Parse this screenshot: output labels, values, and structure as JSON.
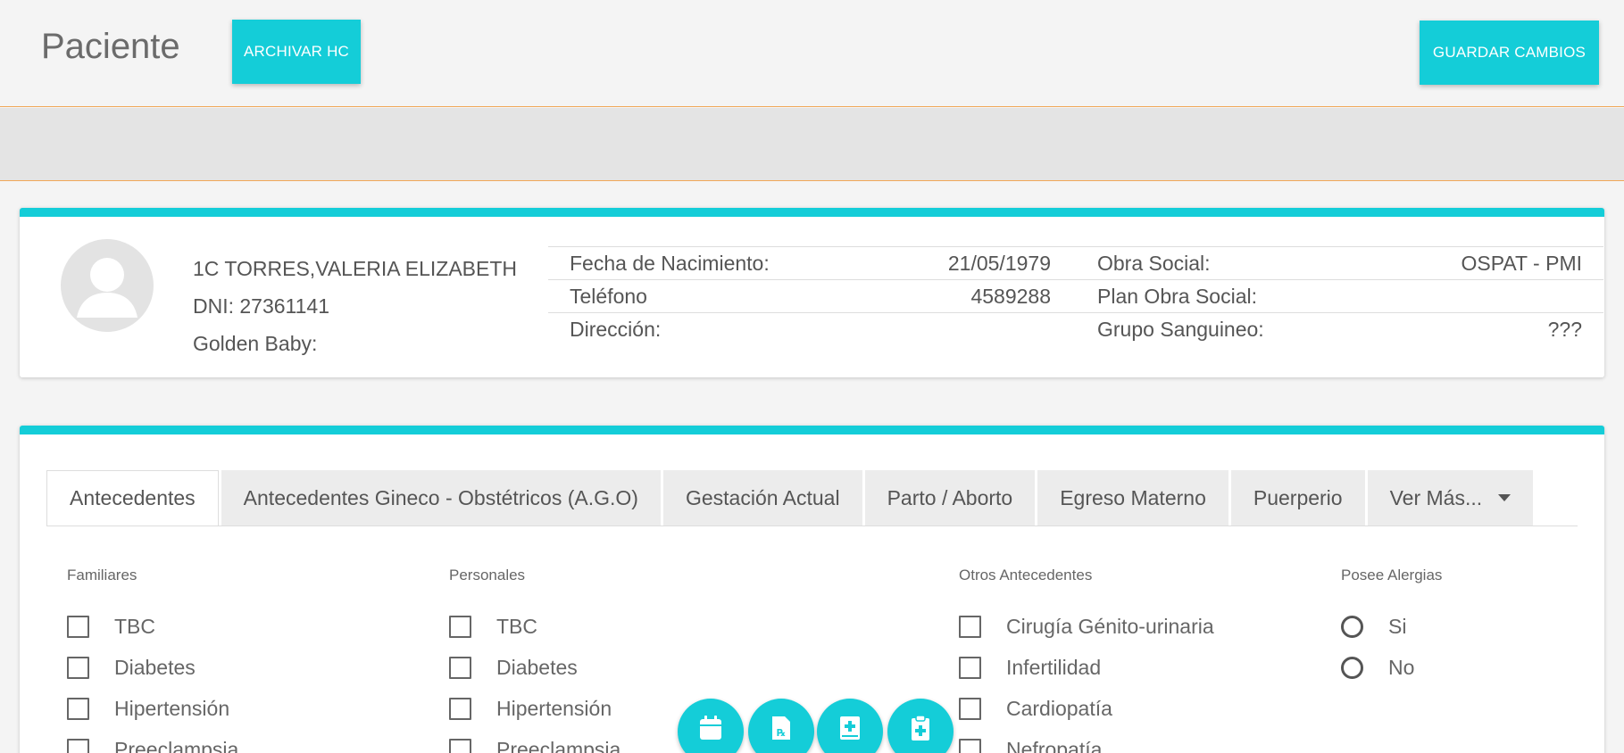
{
  "header": {
    "title": "Paciente",
    "archive_label": "ARCHIVAR HC",
    "save_label": "GUARDAR CAMBIOS"
  },
  "patient": {
    "name": "1C TORRES,VALERIA ELIZABETH",
    "dni": "DNI: 27361141",
    "golden_baby": "Golden Baby:",
    "rows": [
      {
        "l1": "Fecha de Nacimiento:",
        "v1": "21/05/1979",
        "l2": "Obra Social:",
        "v2": "OSPAT - PMI"
      },
      {
        "l1": "Teléfono",
        "v1": "4589288",
        "l2": "Plan Obra Social:",
        "v2": ""
      },
      {
        "l1": "Dirección:",
        "v1": "",
        "l2": "Grupo Sanguineo:",
        "v2": "???"
      }
    ]
  },
  "tabs": [
    {
      "label": "Antecedentes"
    },
    {
      "label": "Antecedentes Gineco - Obstétricos (A.G.O)"
    },
    {
      "label": "Gestación Actual"
    },
    {
      "label": "Parto / Aborto"
    },
    {
      "label": "Egreso Materno"
    },
    {
      "label": "Puerperio"
    },
    {
      "label": "Ver Más..."
    }
  ],
  "familiares": {
    "title": "Familiares",
    "items": [
      "TBC",
      "Diabetes",
      "Hipertensión",
      "Preeclampsia"
    ]
  },
  "personales": {
    "title": "Personales",
    "items": [
      "TBC",
      "Diabetes",
      "Hipertensión",
      "Preeclampsia"
    ]
  },
  "otros": {
    "title": "Otros Antecedentes",
    "items": [
      "Cirugía Génito-urinaria",
      "Infertilidad",
      "Cardiopatía",
      "Nefropatía"
    ]
  },
  "alergias": {
    "title": "Posee Alergias",
    "options": [
      "Si",
      "No"
    ]
  },
  "fabs": [
    "calendar-icon",
    "prescription-icon",
    "medical-book-icon",
    "clipboard-plus-icon"
  ],
  "colors": {
    "accent": "#14cdd8",
    "divider": "#f0a858"
  }
}
